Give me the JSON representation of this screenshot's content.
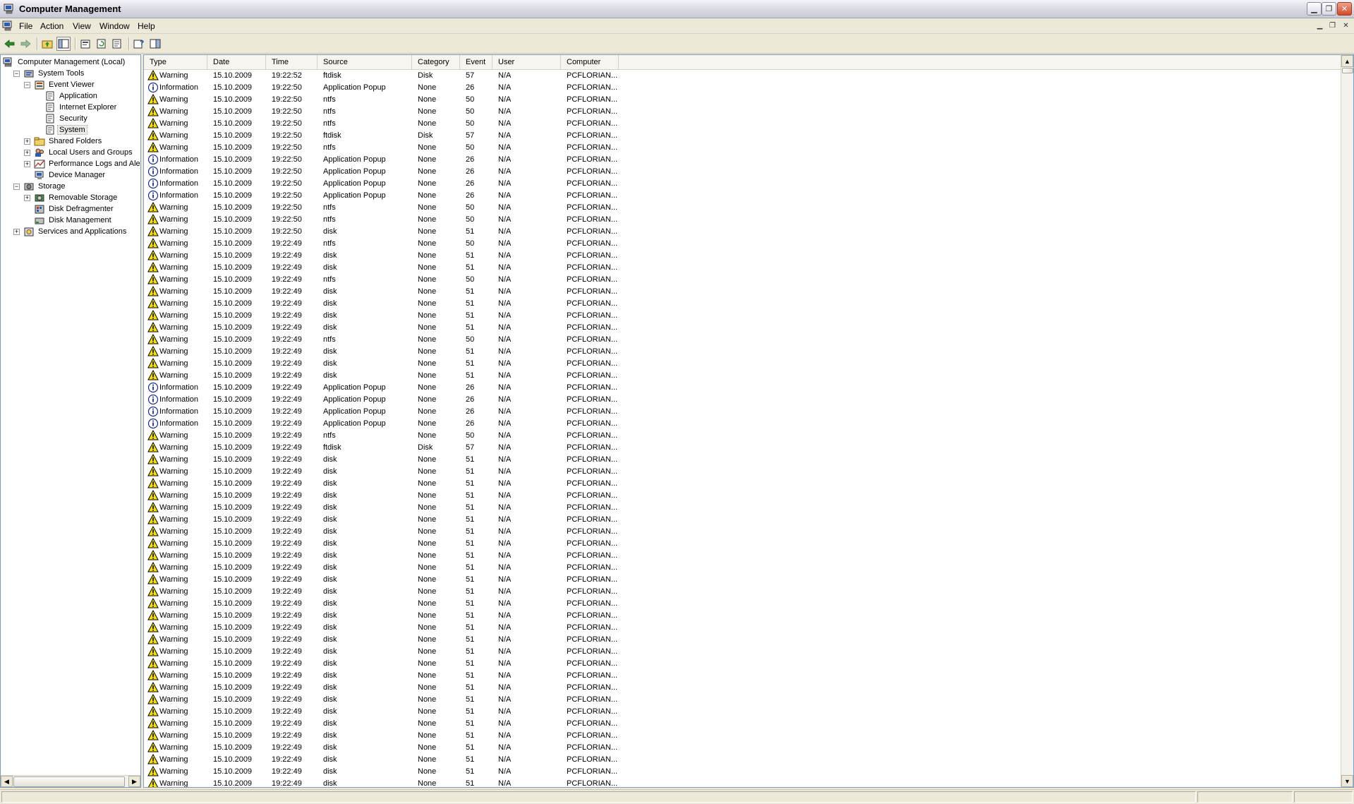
{
  "window": {
    "title": "Computer Management"
  },
  "menu": [
    "File",
    "Action",
    "View",
    "Window",
    "Help"
  ],
  "toolbar": {
    "buttons": [
      "back-icon",
      "forward-icon",
      "up-folder-icon",
      "show-hide-tree-icon",
      "properties-icon",
      "refresh-icon",
      "export-list-icon",
      "help-icon",
      "show-hide-action-pane-icon"
    ]
  },
  "tree": [
    {
      "label": "Computer Management (Local)",
      "level": 0,
      "expander": "",
      "icon": "computer-management-icon",
      "name": "tree-item-computer-management"
    },
    {
      "label": "System Tools",
      "level": 1,
      "expander": "−",
      "icon": "system-tools-icon",
      "name": "tree-item-system-tools"
    },
    {
      "label": "Event Viewer",
      "level": 2,
      "expander": "−",
      "icon": "event-viewer-icon",
      "name": "tree-item-event-viewer"
    },
    {
      "label": "Application",
      "level": 3,
      "expander": "",
      "icon": "event-log-icon",
      "name": "tree-item-application"
    },
    {
      "label": "Internet Explorer",
      "level": 3,
      "expander": "",
      "icon": "event-log-icon",
      "name": "tree-item-internet-explorer"
    },
    {
      "label": "Security",
      "level": 3,
      "expander": "",
      "icon": "event-log-icon",
      "name": "tree-item-security"
    },
    {
      "label": "System",
      "level": 3,
      "expander": "",
      "icon": "event-log-icon",
      "name": "tree-item-system",
      "selected": true
    },
    {
      "label": "Shared Folders",
      "level": 2,
      "expander": "+",
      "icon": "shared-folder-icon",
      "name": "tree-item-shared-folders"
    },
    {
      "label": "Local Users and Groups",
      "level": 2,
      "expander": "+",
      "icon": "users-icon",
      "name": "tree-item-local-users-and-groups"
    },
    {
      "label": "Performance Logs and Alerts",
      "level": 2,
      "expander": "+",
      "icon": "performance-icon",
      "name": "tree-item-performance-logs"
    },
    {
      "label": "Device Manager",
      "level": 2,
      "expander": "",
      "icon": "device-manager-icon",
      "name": "tree-item-device-manager"
    },
    {
      "label": "Storage",
      "level": 1,
      "expander": "−",
      "icon": "storage-icon",
      "name": "tree-item-storage"
    },
    {
      "label": "Removable Storage",
      "level": 2,
      "expander": "+",
      "icon": "removable-storage-icon",
      "name": "tree-item-removable-storage"
    },
    {
      "label": "Disk Defragmenter",
      "level": 2,
      "expander": "",
      "icon": "defragmenter-icon",
      "name": "tree-item-disk-defragmenter"
    },
    {
      "label": "Disk Management",
      "level": 2,
      "expander": "",
      "icon": "disk-management-icon",
      "name": "tree-item-disk-management"
    },
    {
      "label": "Services and Applications",
      "level": 1,
      "expander": "+",
      "icon": "services-icon",
      "name": "tree-item-services-and-applications"
    }
  ],
  "columns": [
    "Type",
    "Date",
    "Time",
    "Source",
    "Category",
    "Event",
    "User",
    "Computer"
  ],
  "events": [
    [
      "Warning",
      "15.10.2009",
      "19:22:52",
      "ftdisk",
      "Disk",
      "57",
      "N/A",
      "PCFLORIAN..."
    ],
    [
      "Information",
      "15.10.2009",
      "19:22:50",
      "Application Popup",
      "None",
      "26",
      "N/A",
      "PCFLORIAN..."
    ],
    [
      "Warning",
      "15.10.2009",
      "19:22:50",
      "ntfs",
      "None",
      "50",
      "N/A",
      "PCFLORIAN..."
    ],
    [
      "Warning",
      "15.10.2009",
      "19:22:50",
      "ntfs",
      "None",
      "50",
      "N/A",
      "PCFLORIAN..."
    ],
    [
      "Warning",
      "15.10.2009",
      "19:22:50",
      "ntfs",
      "None",
      "50",
      "N/A",
      "PCFLORIAN..."
    ],
    [
      "Warning",
      "15.10.2009",
      "19:22:50",
      "ftdisk",
      "Disk",
      "57",
      "N/A",
      "PCFLORIAN..."
    ],
    [
      "Warning",
      "15.10.2009",
      "19:22:50",
      "ntfs",
      "None",
      "50",
      "N/A",
      "PCFLORIAN..."
    ],
    [
      "Information",
      "15.10.2009",
      "19:22:50",
      "Application Popup",
      "None",
      "26",
      "N/A",
      "PCFLORIAN..."
    ],
    [
      "Information",
      "15.10.2009",
      "19:22:50",
      "Application Popup",
      "None",
      "26",
      "N/A",
      "PCFLORIAN..."
    ],
    [
      "Information",
      "15.10.2009",
      "19:22:50",
      "Application Popup",
      "None",
      "26",
      "N/A",
      "PCFLORIAN..."
    ],
    [
      "Information",
      "15.10.2009",
      "19:22:50",
      "Application Popup",
      "None",
      "26",
      "N/A",
      "PCFLORIAN..."
    ],
    [
      "Warning",
      "15.10.2009",
      "19:22:50",
      "ntfs",
      "None",
      "50",
      "N/A",
      "PCFLORIAN..."
    ],
    [
      "Warning",
      "15.10.2009",
      "19:22:50",
      "ntfs",
      "None",
      "50",
      "N/A",
      "PCFLORIAN..."
    ],
    [
      "Warning",
      "15.10.2009",
      "19:22:50",
      "disk",
      "None",
      "51",
      "N/A",
      "PCFLORIAN..."
    ],
    [
      "Warning",
      "15.10.2009",
      "19:22:49",
      "ntfs",
      "None",
      "50",
      "N/A",
      "PCFLORIAN..."
    ],
    [
      "Warning",
      "15.10.2009",
      "19:22:49",
      "disk",
      "None",
      "51",
      "N/A",
      "PCFLORIAN..."
    ],
    [
      "Warning",
      "15.10.2009",
      "19:22:49",
      "disk",
      "None",
      "51",
      "N/A",
      "PCFLORIAN..."
    ],
    [
      "Warning",
      "15.10.2009",
      "19:22:49",
      "ntfs",
      "None",
      "50",
      "N/A",
      "PCFLORIAN..."
    ],
    [
      "Warning",
      "15.10.2009",
      "19:22:49",
      "disk",
      "None",
      "51",
      "N/A",
      "PCFLORIAN..."
    ],
    [
      "Warning",
      "15.10.2009",
      "19:22:49",
      "disk",
      "None",
      "51",
      "N/A",
      "PCFLORIAN..."
    ],
    [
      "Warning",
      "15.10.2009",
      "19:22:49",
      "disk",
      "None",
      "51",
      "N/A",
      "PCFLORIAN..."
    ],
    [
      "Warning",
      "15.10.2009",
      "19:22:49",
      "disk",
      "None",
      "51",
      "N/A",
      "PCFLORIAN..."
    ],
    [
      "Warning",
      "15.10.2009",
      "19:22:49",
      "ntfs",
      "None",
      "50",
      "N/A",
      "PCFLORIAN..."
    ],
    [
      "Warning",
      "15.10.2009",
      "19:22:49",
      "disk",
      "None",
      "51",
      "N/A",
      "PCFLORIAN..."
    ],
    [
      "Warning",
      "15.10.2009",
      "19:22:49",
      "disk",
      "None",
      "51",
      "N/A",
      "PCFLORIAN..."
    ],
    [
      "Warning",
      "15.10.2009",
      "19:22:49",
      "disk",
      "None",
      "51",
      "N/A",
      "PCFLORIAN..."
    ],
    [
      "Information",
      "15.10.2009",
      "19:22:49",
      "Application Popup",
      "None",
      "26",
      "N/A",
      "PCFLORIAN..."
    ],
    [
      "Information",
      "15.10.2009",
      "19:22:49",
      "Application Popup",
      "None",
      "26",
      "N/A",
      "PCFLORIAN..."
    ],
    [
      "Information",
      "15.10.2009",
      "19:22:49",
      "Application Popup",
      "None",
      "26",
      "N/A",
      "PCFLORIAN..."
    ],
    [
      "Information",
      "15.10.2009",
      "19:22:49",
      "Application Popup",
      "None",
      "26",
      "N/A",
      "PCFLORIAN..."
    ],
    [
      "Warning",
      "15.10.2009",
      "19:22:49",
      "ntfs",
      "None",
      "50",
      "N/A",
      "PCFLORIAN..."
    ],
    [
      "Warning",
      "15.10.2009",
      "19:22:49",
      "ftdisk",
      "Disk",
      "57",
      "N/A",
      "PCFLORIAN..."
    ],
    [
      "Warning",
      "15.10.2009",
      "19:22:49",
      "disk",
      "None",
      "51",
      "N/A",
      "PCFLORIAN..."
    ],
    [
      "Warning",
      "15.10.2009",
      "19:22:49",
      "disk",
      "None",
      "51",
      "N/A",
      "PCFLORIAN..."
    ],
    [
      "Warning",
      "15.10.2009",
      "19:22:49",
      "disk",
      "None",
      "51",
      "N/A",
      "PCFLORIAN..."
    ],
    [
      "Warning",
      "15.10.2009",
      "19:22:49",
      "disk",
      "None",
      "51",
      "N/A",
      "PCFLORIAN..."
    ],
    [
      "Warning",
      "15.10.2009",
      "19:22:49",
      "disk",
      "None",
      "51",
      "N/A",
      "PCFLORIAN..."
    ],
    [
      "Warning",
      "15.10.2009",
      "19:22:49",
      "disk",
      "None",
      "51",
      "N/A",
      "PCFLORIAN..."
    ],
    [
      "Warning",
      "15.10.2009",
      "19:22:49",
      "disk",
      "None",
      "51",
      "N/A",
      "PCFLORIAN..."
    ],
    [
      "Warning",
      "15.10.2009",
      "19:22:49",
      "disk",
      "None",
      "51",
      "N/A",
      "PCFLORIAN..."
    ],
    [
      "Warning",
      "15.10.2009",
      "19:22:49",
      "disk",
      "None",
      "51",
      "N/A",
      "PCFLORIAN..."
    ],
    [
      "Warning",
      "15.10.2009",
      "19:22:49",
      "disk",
      "None",
      "51",
      "N/A",
      "PCFLORIAN..."
    ],
    [
      "Warning",
      "15.10.2009",
      "19:22:49",
      "disk",
      "None",
      "51",
      "N/A",
      "PCFLORIAN..."
    ],
    [
      "Warning",
      "15.10.2009",
      "19:22:49",
      "disk",
      "None",
      "51",
      "N/A",
      "PCFLORIAN..."
    ],
    [
      "Warning",
      "15.10.2009",
      "19:22:49",
      "disk",
      "None",
      "51",
      "N/A",
      "PCFLORIAN..."
    ],
    [
      "Warning",
      "15.10.2009",
      "19:22:49",
      "disk",
      "None",
      "51",
      "N/A",
      "PCFLORIAN..."
    ],
    [
      "Warning",
      "15.10.2009",
      "19:22:49",
      "disk",
      "None",
      "51",
      "N/A",
      "PCFLORIAN..."
    ],
    [
      "Warning",
      "15.10.2009",
      "19:22:49",
      "disk",
      "None",
      "51",
      "N/A",
      "PCFLORIAN..."
    ],
    [
      "Warning",
      "15.10.2009",
      "19:22:49",
      "disk",
      "None",
      "51",
      "N/A",
      "PCFLORIAN..."
    ],
    [
      "Warning",
      "15.10.2009",
      "19:22:49",
      "disk",
      "None",
      "51",
      "N/A",
      "PCFLORIAN..."
    ],
    [
      "Warning",
      "15.10.2009",
      "19:22:49",
      "disk",
      "None",
      "51",
      "N/A",
      "PCFLORIAN..."
    ],
    [
      "Warning",
      "15.10.2009",
      "19:22:49",
      "disk",
      "None",
      "51",
      "N/A",
      "PCFLORIAN..."
    ],
    [
      "Warning",
      "15.10.2009",
      "19:22:49",
      "disk",
      "None",
      "51",
      "N/A",
      "PCFLORIAN..."
    ],
    [
      "Warning",
      "15.10.2009",
      "19:22:49",
      "disk",
      "None",
      "51",
      "N/A",
      "PCFLORIAN..."
    ],
    [
      "Warning",
      "15.10.2009",
      "19:22:49",
      "disk",
      "None",
      "51",
      "N/A",
      "PCFLORIAN..."
    ],
    [
      "Warning",
      "15.10.2009",
      "19:22:49",
      "disk",
      "None",
      "51",
      "N/A",
      "PCFLORIAN..."
    ],
    [
      "Warning",
      "15.10.2009",
      "19:22:49",
      "disk",
      "None",
      "51",
      "N/A",
      "PCFLORIAN..."
    ],
    [
      "Warning",
      "15.10.2009",
      "19:22:49",
      "disk",
      "None",
      "51",
      "N/A",
      "PCFLORIAN..."
    ],
    [
      "Warning",
      "15.10.2009",
      "19:22:49",
      "disk",
      "None",
      "51",
      "N/A",
      "PCFLORIAN..."
    ],
    [
      "Warning",
      "15.10.2009",
      "19:22:49",
      "disk",
      "None",
      "51",
      "N/A",
      "PCFLORIAN..."
    ]
  ]
}
